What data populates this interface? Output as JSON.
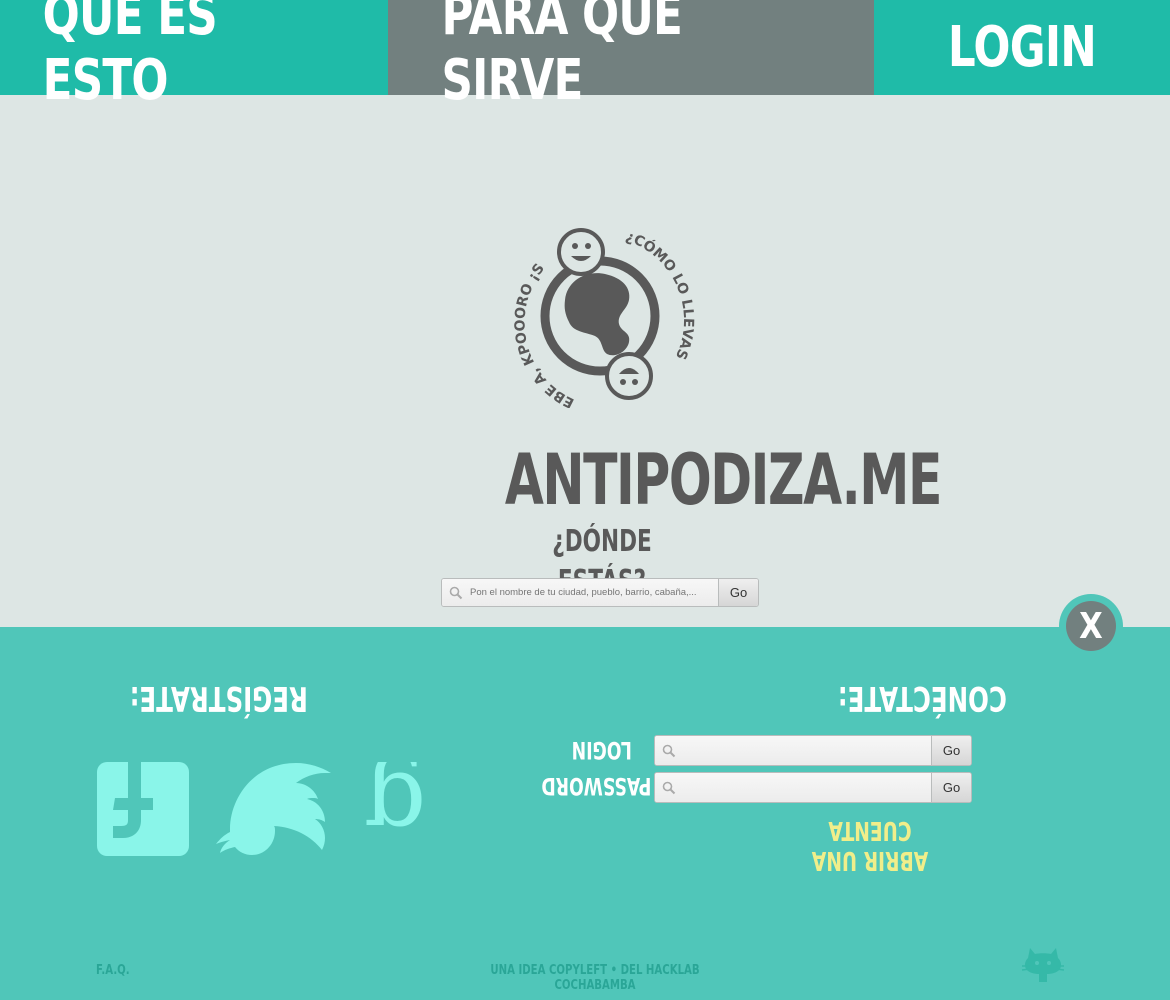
{
  "nav": {
    "items": [
      {
        "label": "QUÉ ES ESTO"
      },
      {
        "label": "PARA QUÉ SIRVE"
      },
      {
        "label": "LOGIN"
      }
    ]
  },
  "hero": {
    "logo_ring_text_left": "EBE A, KPOOORO ¡SI ALA!",
    "logo_ring_text_right": "¿CÓMO LO LLEVAS?",
    "site_name": "ANTIPODIZA.ME",
    "tagline": "¿DÓNDE ESTÁS?",
    "search": {
      "placeholder": "Pon el nombre de tu ciudad, pueblo, barrio, cabaña,...",
      "button": "Go"
    }
  },
  "panel": {
    "close_label": "X",
    "register_title": "REGÍSTRATE:",
    "connect_title": "CONÉCTATE:",
    "login_label": "LOGIN",
    "password_label": "PASSWORD",
    "login_button": "Go",
    "password_button": "Go",
    "open_account": "ABRIR UNA CUENTA",
    "social_icons": [
      "facebook-icon",
      "twitter-icon",
      "google-plus-icon"
    ]
  },
  "footer": {
    "faq": "F.A.Q.",
    "credit": "UNA IDEA COPYLEFT • DEL HACKLAB COCHABAMBA"
  },
  "colors": {
    "nav_teal": "#1fbba8",
    "nav_gray": "#72807f",
    "background": "#dde6e4",
    "panel": "#50c6b9",
    "social_icon": "#8af5e9",
    "text_dark": "#595959",
    "accent_yellow": "#f0ee8a"
  }
}
